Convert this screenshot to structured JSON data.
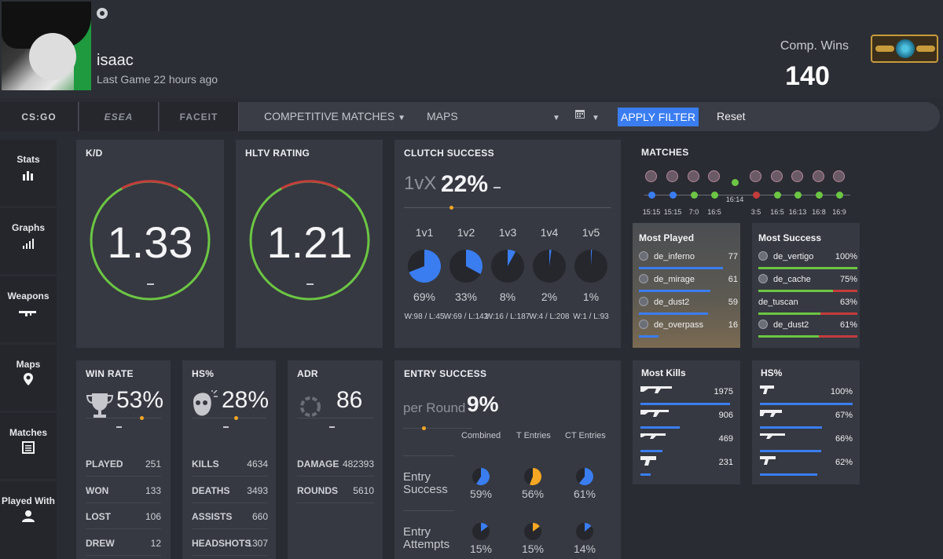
{
  "profile": {
    "name": "isaac",
    "last_game": "Last Game 22 hours ago",
    "wins_label": "Comp. Wins",
    "wins_value": "140"
  },
  "filter": {
    "tabs": [
      "CS:GO",
      "ESEA",
      "FACEIT"
    ],
    "matches_filter": "COMPETITIVE MATCHES",
    "maps_filter": "MAPS",
    "apply": "APPLY FILTER",
    "reset": "Reset"
  },
  "sidebar": {
    "items": [
      {
        "label": "Stats",
        "icon": "bar-chart-icon"
      },
      {
        "label": "Graphs",
        "icon": "signal-bars-icon"
      },
      {
        "label": "Weapons",
        "icon": "rifle-icon"
      },
      {
        "label": "Maps",
        "icon": "map-pin-icon"
      },
      {
        "label": "Matches",
        "icon": "list-icon"
      },
      {
        "label": "Played With",
        "icon": "person-icon"
      }
    ]
  },
  "kd": {
    "title": "K/D",
    "value": "1.33",
    "dash": "–"
  },
  "hltv": {
    "title": "HLTV RATING",
    "value": "1.21",
    "dash": "–"
  },
  "clutch": {
    "title": "CLUTCH SUCCESS",
    "prefix": "1vX",
    "value": "22%",
    "dash": "–",
    "columns": [
      {
        "label": "1v1",
        "pct": "69%",
        "wl": "W:98 / L:45",
        "fraction": 0.69
      },
      {
        "label": "1v2",
        "pct": "33%",
        "wl": "W:69 / L:142",
        "fraction": 0.33
      },
      {
        "label": "1v3",
        "pct": "8%",
        "wl": "W:16 / L:187",
        "fraction": 0.08
      },
      {
        "label": "1v4",
        "pct": "2%",
        "wl": "W:4 / L:208",
        "fraction": 0.02
      },
      {
        "label": "1v5",
        "pct": "1%",
        "wl": "W:1 / L:93",
        "fraction": 0.01
      }
    ]
  },
  "matches": {
    "title": "MATCHES",
    "scores": [
      "15:15",
      "15:15",
      "7:0",
      "16:5",
      "16:14",
      "3:5",
      "16:5",
      "16:13",
      "16:8",
      "16:9"
    ]
  },
  "most_played": {
    "title": "Most Played",
    "rows": [
      {
        "map": "de_inferno",
        "count": "77"
      },
      {
        "map": "de_mirage",
        "count": "61"
      },
      {
        "map": "de_dust2",
        "count": "59"
      },
      {
        "map": "de_overpass",
        "count": "16"
      }
    ]
  },
  "most_success": {
    "title": "Most Success",
    "rows": [
      {
        "map": "de_vertigo",
        "pct": "100%"
      },
      {
        "map": "de_cache",
        "pct": "75%"
      },
      {
        "map": "de_tuscan",
        "pct": "63%"
      },
      {
        "map": "de_dust2",
        "pct": "61%"
      }
    ]
  },
  "win_rate": {
    "title": "WIN RATE",
    "value": "53%",
    "dash": "–",
    "rows": [
      {
        "label": "PLAYED",
        "value": "251"
      },
      {
        "label": "WON",
        "value": "133"
      },
      {
        "label": "LOST",
        "value": "106"
      },
      {
        "label": "DREW",
        "value": "12"
      }
    ]
  },
  "hs": {
    "title": "HS%",
    "value": "28%",
    "dash": "–",
    "rows": [
      {
        "label": "KILLS",
        "value": "4634"
      },
      {
        "label": "DEATHS",
        "value": "3493"
      },
      {
        "label": "ASSISTS",
        "value": "660"
      },
      {
        "label": "HEADSHOTS",
        "value": "1307"
      }
    ]
  },
  "adr": {
    "title": "ADR",
    "value": "86",
    "dash": "–",
    "rows": [
      {
        "label": "DAMAGE",
        "value": "482393"
      },
      {
        "label": "ROUNDS",
        "value": "5610"
      }
    ]
  },
  "entry": {
    "title": "ENTRY SUCCESS",
    "prefix": "per Round",
    "value": "9%",
    "col_headers": [
      "Combined",
      "T Entries",
      "CT Entries"
    ],
    "rows": [
      {
        "label": "Entry Success",
        "values": [
          "59%",
          "56%",
          "61%"
        ],
        "fractions": [
          0.59,
          0.56,
          0.61
        ]
      },
      {
        "label": "Entry Attempts",
        "values": [
          "15%",
          "15%",
          "14%"
        ],
        "fractions": [
          0.15,
          0.15,
          0.14
        ]
      }
    ]
  },
  "most_kills": {
    "title": "Most Kills",
    "rows": [
      {
        "weapon": "ak47-icon",
        "count": "1975"
      },
      {
        "weapon": "m4a4-icon",
        "count": "906"
      },
      {
        "weapon": "awp-icon",
        "count": "469"
      },
      {
        "weapon": "deagle-icon",
        "count": "231"
      }
    ]
  },
  "weapon_hs": {
    "title": "HS%",
    "rows": [
      {
        "weapon": "pistol-icon",
        "pct": "100%"
      },
      {
        "weapon": "smg-icon",
        "pct": "67%"
      },
      {
        "weapon": "shotgun-icon",
        "pct": "66%"
      },
      {
        "weapon": "usp-icon",
        "pct": "62%"
      }
    ]
  },
  "colors": {
    "accent": "#3a7df0",
    "positive": "#6cc644",
    "negative": "#c43c3c",
    "orange": "#f5a623"
  }
}
